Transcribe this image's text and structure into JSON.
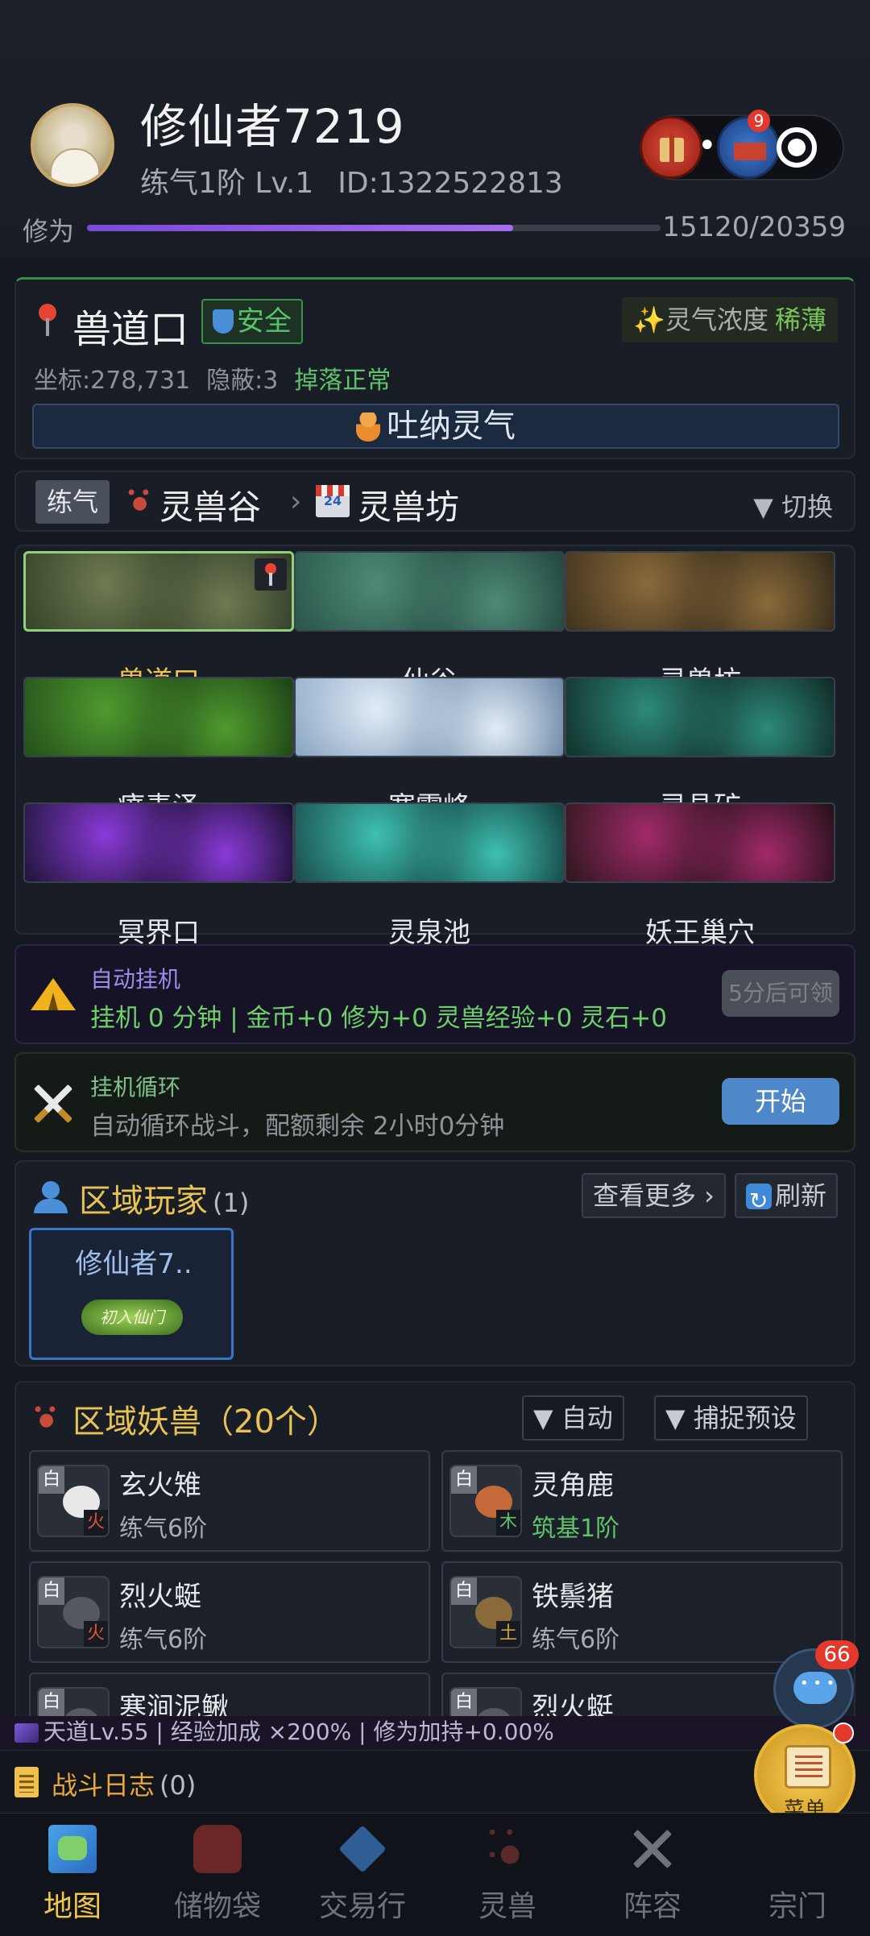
{
  "header": {
    "username": "修仙者7219",
    "realm_level": "练气1阶 Lv.1",
    "id_text": "ID:1322522813",
    "cultivation_label": "修为",
    "cultivation_value": "15120/20359",
    "cultivation_progress": 0.743,
    "mail_badge": "9",
    "more_dots": "•••"
  },
  "location": {
    "name": "兽道口",
    "safety": "安全",
    "aura_label": "灵气浓度",
    "aura_level": "稀薄",
    "coords": "坐标:278,731",
    "stealth": "隐蔽:3",
    "drop_status": "掉落正常",
    "breathe_button": "吐纳灵气"
  },
  "area_nav": {
    "tag": "练气",
    "region": "灵兽谷",
    "separator": "›",
    "subregion": "灵兽坊",
    "switch_label": "▼ 切换"
  },
  "map_tiles": [
    {
      "name": "兽道口",
      "active": true,
      "colors": [
        "#3b4a2c",
        "#6e7a52",
        "#2e3a26"
      ]
    },
    {
      "name": "仙谷",
      "active": false,
      "colors": [
        "#2f5f52",
        "#4e8a78",
        "#1f3f38"
      ]
    },
    {
      "name": "灵兽坊",
      "active": false,
      "colors": [
        "#4a3a22",
        "#8a6a3a",
        "#2a2418"
      ]
    },
    {
      "name": "瘴毒泽",
      "active": false,
      "colors": [
        "#2a5a1e",
        "#4f9a2e",
        "#1a3a14"
      ]
    },
    {
      "name": "寒霜峰",
      "active": false,
      "colors": [
        "#9cb6d2",
        "#e2ecf6",
        "#5e7a98"
      ]
    },
    {
      "name": "灵晶矿",
      "active": false,
      "colors": [
        "#143a34",
        "#2e8a7a",
        "#0e2420"
      ]
    },
    {
      "name": "冥界口",
      "active": false,
      "colors": [
        "#2a1a4a",
        "#8a3ad8",
        "#140c24"
      ]
    },
    {
      "name": "灵泉池",
      "active": false,
      "colors": [
        "#1e5a5a",
        "#3ec0b0",
        "#123a3a"
      ]
    },
    {
      "name": "妖王巢穴",
      "active": false,
      "colors": [
        "#3a1a24",
        "#a02a6a",
        "#1e0e14"
      ]
    }
  ],
  "auto_hang": {
    "title": "自动挂机",
    "stats": "挂机 0 分钟 | 金币+0 修为+0 灵兽经验+0 灵石+0",
    "claim_button": "5分后可领"
  },
  "loop": {
    "title": "挂机循环",
    "description": "自动循环战斗，配额剩余 2小时0分钟",
    "start_button": "开始"
  },
  "region_players": {
    "title": "区域玩家",
    "count": "(1)",
    "more_button": "查看更多 ›",
    "refresh_button": "刷新",
    "players": [
      {
        "name": "修仙者7..",
        "badge": "初入仙门"
      }
    ]
  },
  "region_beasts": {
    "title": "区域妖兽（20个）",
    "auto_button": "▼ 自动",
    "capture_button": "▼ 捕捉预设",
    "beasts": [
      {
        "name": "玄火雉",
        "level": "练气6阶",
        "rarity": "白",
        "element": "火",
        "element_color": "#e0553a",
        "level_green": false,
        "body_color": "#e8e8e8"
      },
      {
        "name": "灵角鹿",
        "level": "筑基1阶",
        "rarity": "白",
        "element": "木",
        "element_color": "#5fc36c",
        "level_green": true,
        "body_color": "#c46a3a"
      },
      {
        "name": "烈火蜓",
        "level": "练气6阶",
        "rarity": "白",
        "element": "火",
        "element_color": "#e0553a",
        "level_green": false,
        "body_color": "#55585e"
      },
      {
        "name": "铁鬃猪",
        "level": "练气6阶",
        "rarity": "白",
        "element": "土",
        "element_color": "#d2a23a",
        "level_green": false,
        "body_color": "#8a6a3a"
      },
      {
        "name": "寒涧泥鳅",
        "level": "",
        "rarity": "白",
        "element": "",
        "element_color": "#5aa5ea",
        "level_green": false,
        "body_color": "#55585e"
      },
      {
        "name": "烈火蜓",
        "level": "",
        "rarity": "白",
        "element": "",
        "element_color": "#e0553a",
        "level_green": false,
        "body_color": "#55585e"
      }
    ]
  },
  "dao_bar": "天道Lv.55 | 经验加成 ×200% | 修为加持+0.00%",
  "battle_log": {
    "label": "战斗日志",
    "count": "(0)"
  },
  "fab": {
    "chat_badge": "66",
    "menu_label": "菜单"
  },
  "tabs": [
    {
      "label": "地图",
      "icon": "map-icon",
      "active": true
    },
    {
      "label": "储物袋",
      "icon": "bag-icon",
      "active": false
    },
    {
      "label": "交易行",
      "icon": "gem-icon",
      "active": false
    },
    {
      "label": "灵兽",
      "icon": "paw-icon",
      "active": false
    },
    {
      "label": "阵容",
      "icon": "crossed-swords-icon",
      "active": false
    },
    {
      "label": "宗门",
      "icon": "temple-icon",
      "active": false
    }
  ]
}
